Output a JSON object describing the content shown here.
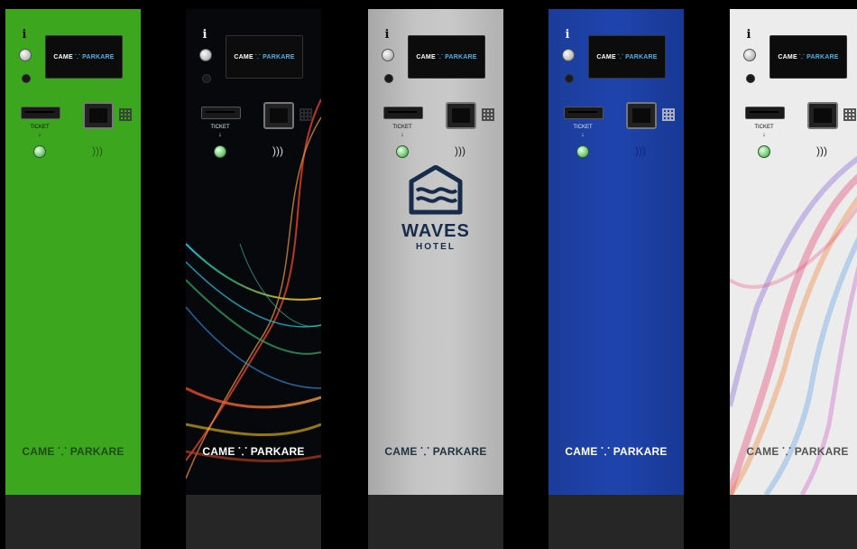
{
  "kiosks": [
    {
      "id": "green",
      "screen_logo_left": "CAME",
      "screen_logo_right": "PARKARE",
      "ticket_label": "TICKET",
      "ticket_arrow": "↓",
      "brand_left": "CAME",
      "brand_right": "PARKARE",
      "color": "#3da61f"
    },
    {
      "id": "dark",
      "screen_logo_left": "CAME",
      "screen_logo_right": "PARKARE",
      "ticket_label": "TICKET",
      "ticket_arrow": "↓",
      "brand_left": "CAME",
      "brand_right": "PARKARE",
      "color": "#07080c"
    },
    {
      "id": "silver",
      "screen_logo_left": "CAME",
      "screen_logo_right": "PARKARE",
      "ticket_label": "TICKET",
      "ticket_arrow": "↓",
      "brand_left": "CAME",
      "brand_right": "PARKARE",
      "color": "#c4c4c4",
      "logo_title": "WAVES",
      "logo_subtitle": "HOTEL"
    },
    {
      "id": "blue",
      "screen_logo_left": "CAME",
      "screen_logo_right": "PARKARE",
      "ticket_label": "TICKET",
      "ticket_arrow": "↓",
      "brand_left": "CAME",
      "brand_right": "PARKARE",
      "color": "#1e44ad"
    },
    {
      "id": "white",
      "screen_logo_left": "CAME",
      "screen_logo_right": "PARKARE",
      "ticket_label": "TICKET",
      "ticket_arrow": "↓",
      "brand_left": "CAME",
      "brand_right": "PARKARE",
      "color": "#ececec"
    }
  ],
  "icons": {
    "info": "i",
    "nfc": ")))",
    "brand_mark": "⸪"
  }
}
